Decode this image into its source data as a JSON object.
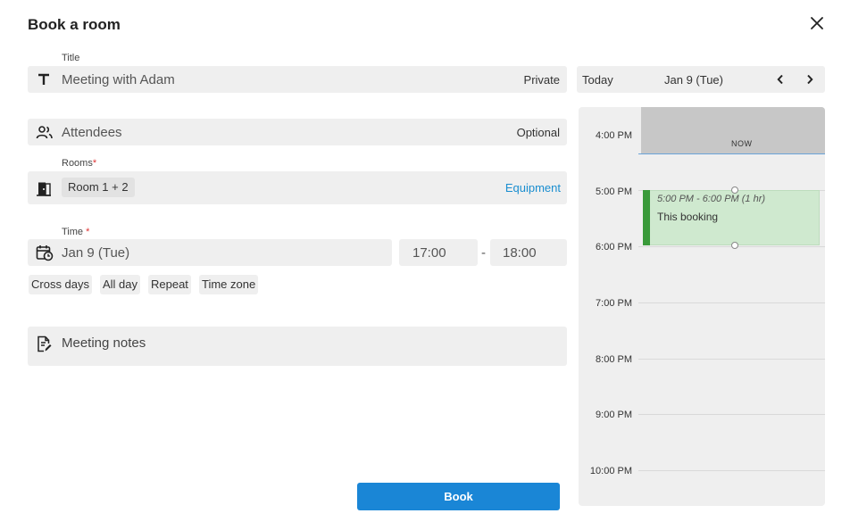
{
  "dialog": {
    "title": "Book a room"
  },
  "form": {
    "title_label": "Title",
    "title_value": "Meeting with Adam",
    "private_label": "Private",
    "attendees_placeholder": "Attendees",
    "optional_label": "Optional",
    "rooms_label": "Rooms",
    "required_marker": "*",
    "room_chip": "Room 1 + 2",
    "equipment_label": "Equipment",
    "time_label": "Time",
    "date_value": "Jan 9 (Tue)",
    "start_time": "17:00",
    "time_separator": "-",
    "end_time": "18:00",
    "options": [
      "Cross days",
      "All day",
      "Repeat",
      "Time zone"
    ],
    "notes_label": "Meeting notes",
    "book_label": "Book"
  },
  "calendar": {
    "today_label": "Today",
    "date_label": "Jan 9 (Tue)",
    "prev_icon": "chevron-left-icon",
    "next_icon": "chevron-right-icon",
    "hours": [
      "4:00 PM",
      "5:00 PM",
      "6:00 PM",
      "7:00 PM",
      "8:00 PM",
      "9:00 PM",
      "10:00 PM"
    ],
    "now_label": "NOW",
    "event": {
      "time": "5:00 PM - 6:00 PM (1 hr)",
      "title": "This booking"
    },
    "colors": {
      "event_bar": "#3a9a3a",
      "event_bg": "#cfe9cf",
      "now_line": "#6aa3d8",
      "book_button": "#1a86d6"
    }
  }
}
